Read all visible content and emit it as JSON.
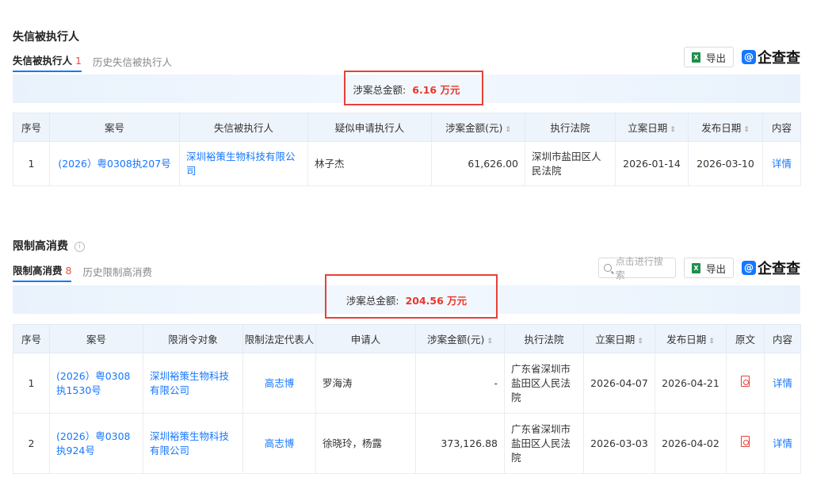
{
  "sec1": {
    "title": "失信被执行人",
    "tab_active": "失信被执行人",
    "tab_active_count": "1",
    "tab_history": "历史失信被执行人",
    "export_label": "导出",
    "brand": "企查查",
    "total_label": "涉案总金额:",
    "total_amount": "6.16 万元",
    "columns": [
      "序号",
      "案号",
      "失信被执行人",
      "疑似申请执行人",
      "涉案金额(元)",
      "执行法院",
      "立案日期",
      "发布日期",
      "内容"
    ],
    "rows": [
      {
        "no": "1",
        "case": "(2026）粤0308执207号",
        "debtor": "深圳裕策生物科技有限公司",
        "applicant": "林子杰",
        "amount": "61,626.00",
        "court": "深圳市盐田区人民法院",
        "filed": "2026-01-14",
        "published": "2026-03-10",
        "action": "详情"
      }
    ]
  },
  "sec2": {
    "title": "限制高消费",
    "tab_active": "限制高消费",
    "tab_active_count": "8",
    "tab_history": "历史限制高消费",
    "search_placeholder": "点击进行搜索",
    "export_label": "导出",
    "brand": "企查查",
    "total_label": "涉案总金额:",
    "total_amount": "204.56 万元",
    "columns": [
      "序号",
      "案号",
      "限消令对象",
      "限制法定代表人",
      "申请人",
      "涉案金额(元)",
      "执行法院",
      "立案日期",
      "发布日期",
      "原文",
      "内容"
    ],
    "rows": [
      {
        "no": "1",
        "case": "(2026）粤0308执1530号",
        "target": "深圳裕策生物科技有限公司",
        "rep": "高志博",
        "applicant": "罗海涛",
        "amount": "-",
        "court": "广东省深圳市盐田区人民法院",
        "filed": "2026-04-07",
        "published": "2026-04-21",
        "action": "详情"
      },
      {
        "no": "2",
        "case": "(2026）粤0308执924号",
        "target": "深圳裕策生物科技有限公司",
        "rep": "高志博",
        "applicant": "徐晓玲，杨露",
        "amount": "373,126.88",
        "court": "广东省深圳市盐田区人民法院",
        "filed": "2026-03-03",
        "published": "2026-04-02",
        "action": "详情"
      }
    ]
  }
}
